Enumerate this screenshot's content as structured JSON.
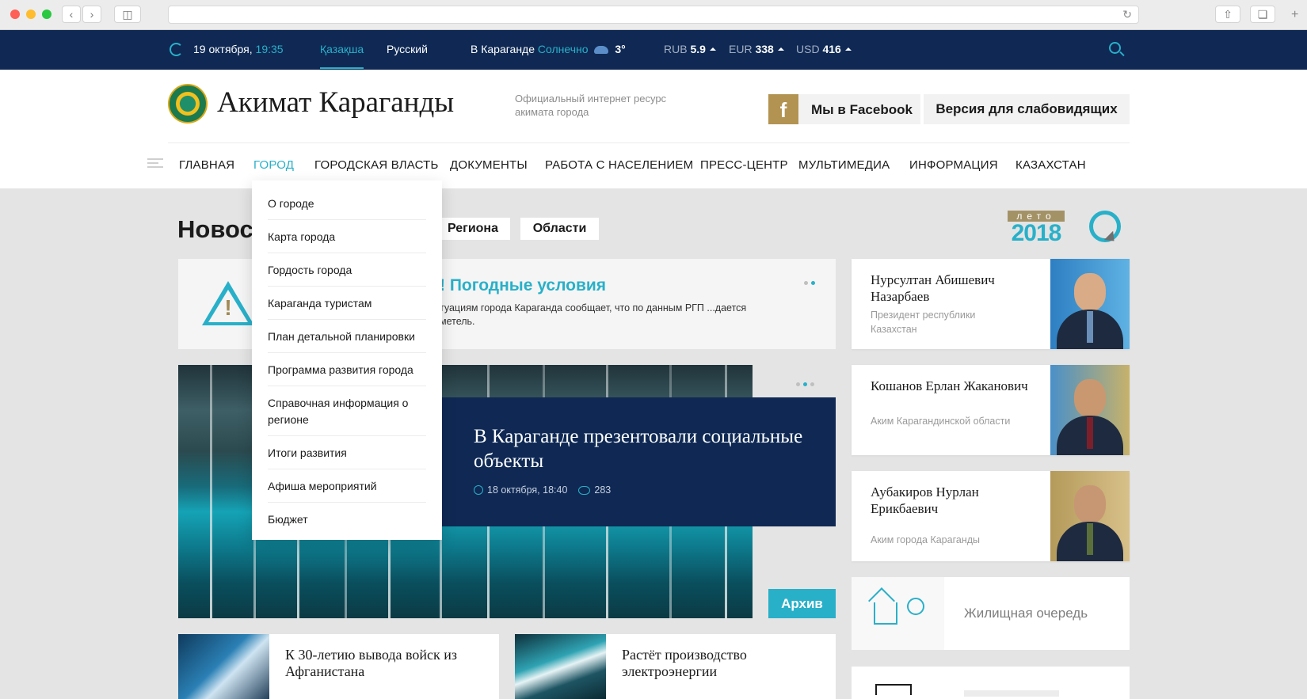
{
  "topbar": {
    "date": "19 октября,",
    "time": "19:35",
    "lang_kz": "Қазақша",
    "lang_ru": "Русский",
    "weather_city": "В Караганде",
    "weather_state": "Солнечно",
    "weather_temp": "3°",
    "currencies": [
      {
        "code": "RUB",
        "value": "5.9"
      },
      {
        "code": "EUR",
        "value": "338"
      },
      {
        "code": "USD",
        "value": "416"
      }
    ]
  },
  "header": {
    "title": "Акимат Караганды",
    "subtitle": "Официальный интернет ресурс акимата города",
    "facebook_label": "Мы в Facebook",
    "facebook_icon_text": "f",
    "vision_label": "Версия для слабовидящих"
  },
  "nav": {
    "items": [
      "ГЛАВНАЯ",
      "ГОРОД",
      "ГОРОДСКАЯ ВЛАСТЬ",
      "ДОКУМЕНТЫ",
      "РАБОТА С НАСЕЛЕНИЕМ",
      "ПРЕСС-ЦЕНТР",
      "МУЛЬТИМЕДИА",
      "ИНФОРМАЦИЯ",
      "КАЗАХСТАН"
    ],
    "active": "ГОРОД"
  },
  "dropdown": {
    "items": [
      "О городе",
      "Карта города",
      "Гордость города",
      "Караганда туристам",
      "План детальной планировки",
      "Программа развития города",
      "Справочная информация о регионе",
      "Итоги развития",
      "Афиша мероприятий",
      "Бюджет"
    ]
  },
  "news": {
    "heading": "Новос",
    "tabs": [
      "Региона",
      "Области"
    ],
    "badge_top": "лето",
    "badge_year": "2018",
    "alert_title": "! Погодные условия",
    "alert_text": "туациям города Караганда сообщает, что по данным РГП ...дается метель.",
    "feature_title": "В Караганде презентовали социальные объекты",
    "feature_date": "18 октября, 18:40",
    "feature_views": "283",
    "archive_label": "Архив",
    "small": [
      {
        "title": "К 30-летию вывода войск из Афганистана"
      },
      {
        "title": "Растёт производство электроэнергии"
      }
    ]
  },
  "persons": [
    {
      "name": "Нурсултан Абишевич Назарбаев",
      "role": "Президент республики Казахстан"
    },
    {
      "name": "Кошанов Ерлан Жаканович",
      "role": "Аким Карагандинской области"
    },
    {
      "name": "Аубакиров Нурлан Ерикбаевич",
      "role": "Аким города Караганды"
    }
  ],
  "services": [
    {
      "label": "Жилищная очередь",
      "icon": "house-tree-icon"
    }
  ],
  "colors": {
    "brand_dark": "#0f2954",
    "accent": "#29b0c9",
    "gold": "#a49267"
  }
}
